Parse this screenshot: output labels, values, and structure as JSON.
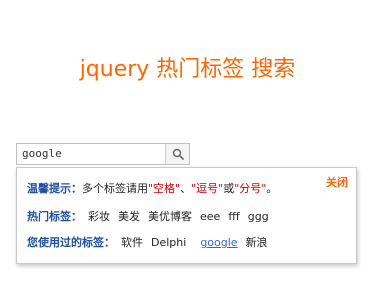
{
  "header": {
    "title": "jquery 热门标签 搜索"
  },
  "search": {
    "value": "google",
    "button_icon": "search-icon"
  },
  "panel": {
    "close_label": "关闭",
    "tip": {
      "label": "温馨提示：",
      "parts": [
        "多个标签请用",
        "\"空格\"",
        "、",
        "\"逗号\"",
        "或",
        "\"分号\"",
        "。"
      ]
    },
    "hot": {
      "label": "热门标签：",
      "tags": [
        "彩妆",
        "美发",
        "美优博客",
        "eee",
        "fff",
        "ggg"
      ]
    },
    "used": {
      "label": "您使用过的标签：",
      "tags": [
        "软件",
        "Delphi",
        "google",
        "新浪"
      ]
    }
  },
  "colors": {
    "accent": "#ff6600",
    "label": "#1f4f9f",
    "highlight": "#cc0000",
    "link": "#3366cc"
  }
}
